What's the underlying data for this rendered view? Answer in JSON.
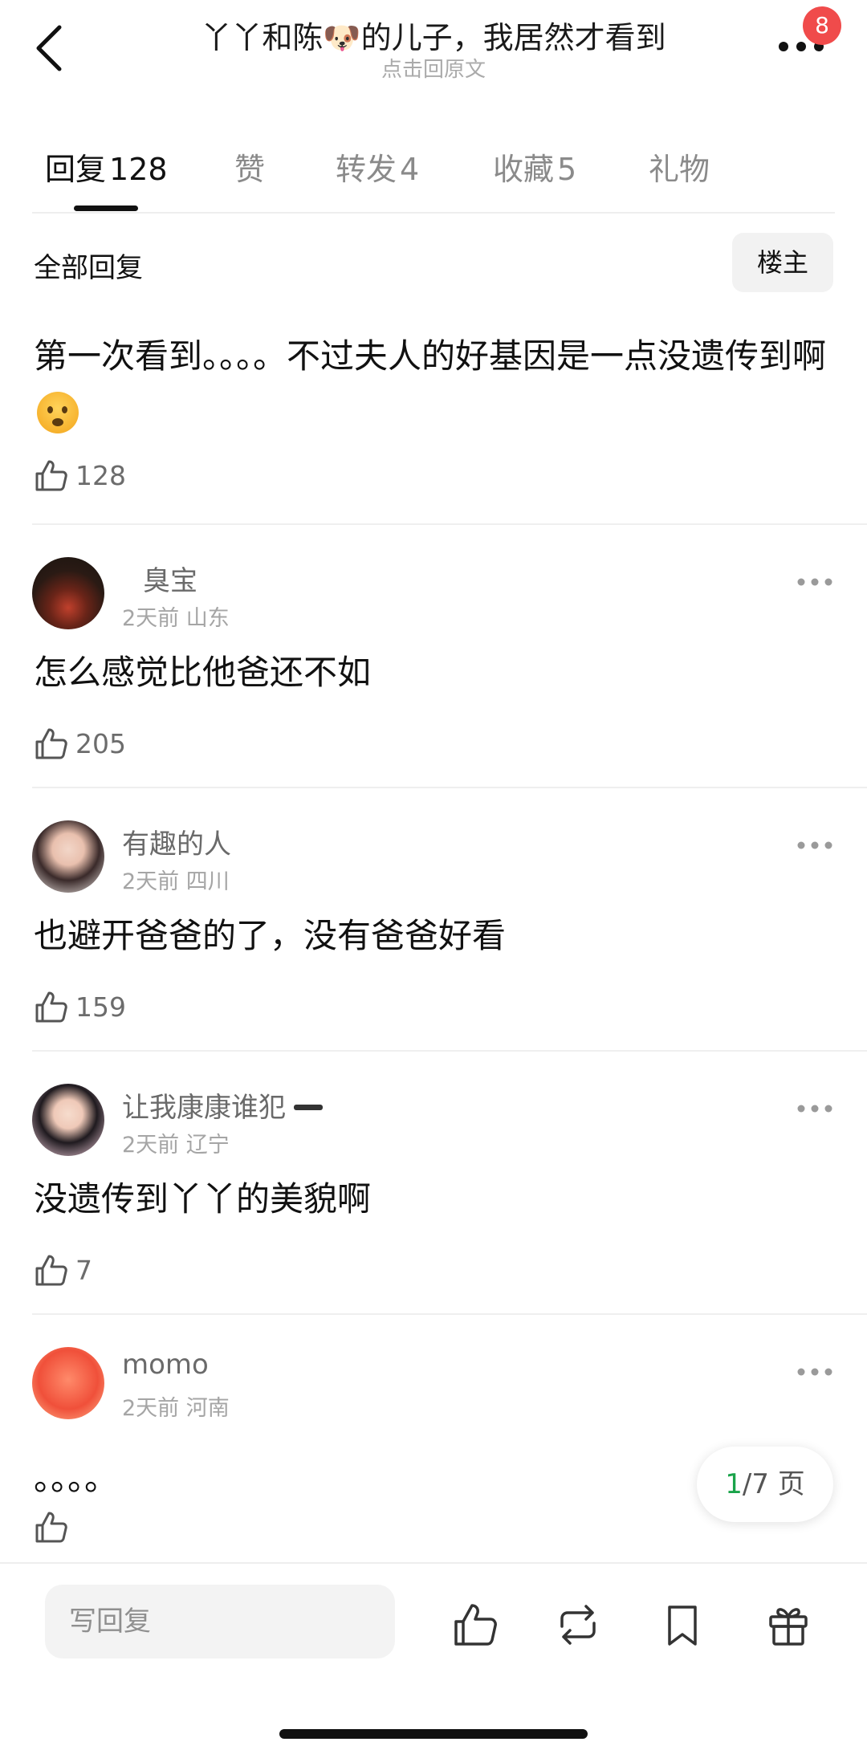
{
  "header": {
    "title": "丫丫和陈🐶的儿子，我居然才看到",
    "subtitle": "点击回原文",
    "badge": "8",
    "icons": {
      "back": "back-chevron-icon",
      "more": "more-dots-icon"
    }
  },
  "tabs": [
    {
      "label": "回复",
      "count": "128",
      "active": true
    },
    {
      "label": "赞",
      "count": "",
      "active": false
    },
    {
      "label": "转发",
      "count": "4",
      "active": false
    },
    {
      "label": "收藏",
      "count": "5",
      "active": false
    },
    {
      "label": "礼物",
      "count": "",
      "active": false
    }
  ],
  "filter": {
    "label": "全部回复",
    "owner_button": "楼主"
  },
  "main_post": {
    "text": "第一次看到。。。。不过夫人的好基因是一点没遗传到啊",
    "emoji": "😦",
    "likes": "128"
  },
  "comments": [
    {
      "user": "臭宝",
      "time": "2天前",
      "location": "山东",
      "text": "怎么感觉比他爸还不如",
      "likes": "205"
    },
    {
      "user": "有趣的人",
      "time": "2天前",
      "location": "四川",
      "text": "也避开爸爸的了，没有爸爸好看",
      "likes": "159"
    },
    {
      "user": "让我康康谁犯",
      "time": "2天前",
      "location": "辽宁",
      "text": "没遗传到丫丫的美貌啊",
      "likes": "7"
    },
    {
      "user": "momo",
      "time": "2天前",
      "location": "河南",
      "text": "。。。。",
      "likes": ""
    }
  ],
  "pager": {
    "current": "1",
    "total": "/7 页"
  },
  "bottom_bar": {
    "reply_placeholder": "写回复",
    "icons": [
      "thumbs-up-icon",
      "repost-icon",
      "bookmark-icon",
      "gift-icon"
    ]
  },
  "colors": {
    "accent_green": "#1aa34a",
    "badge_red": "#f04b4b",
    "text_primary": "#111111",
    "text_secondary": "#a5a5a5"
  }
}
